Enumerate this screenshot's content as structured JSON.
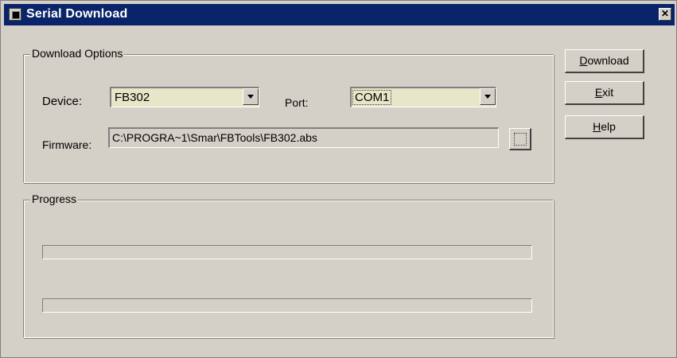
{
  "window": {
    "title": "Serial Download",
    "close_glyph": "✕"
  },
  "download_options": {
    "group_label": "Download Options",
    "device_label": "Device:",
    "device_value": "FB302",
    "port_label": "Port:",
    "port_value": "COM1",
    "firmware_label": "Firmware:",
    "firmware_value": "C:\\PROGRA~1\\Smar\\FBTools\\FB302.abs"
  },
  "progress": {
    "group_label": "Progress",
    "bar1_fraction": 0,
    "bar2_fraction": 0
  },
  "buttons": {
    "download": {
      "mnemonic": "D",
      "rest": "ownload"
    },
    "exit": {
      "mnemonic": "E",
      "rest": "xit"
    },
    "help": {
      "mnemonic": "H",
      "rest": "elp"
    }
  },
  "colors": {
    "titlebar": "#0a246a",
    "dialog_face": "#d4d0c8",
    "combo_background": "#e6e6c8"
  },
  "icons": {
    "title": "app-window-icon",
    "close": "close-icon",
    "dropdown": "chevron-down-icon",
    "browse": "browse-folder-icon"
  }
}
